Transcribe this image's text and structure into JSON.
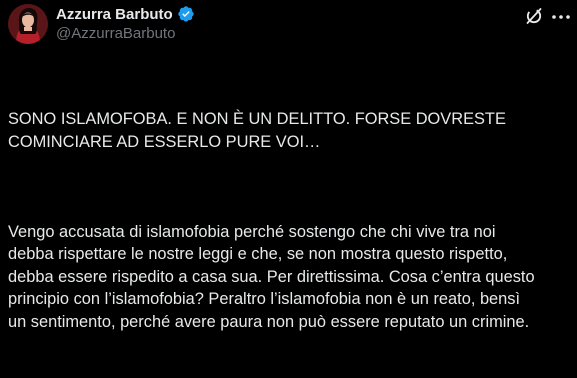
{
  "post": {
    "author": {
      "display_name": "Azzurra Barbuto",
      "handle": "@AzzurraBarbuto",
      "verified": true
    },
    "icons": {
      "avatar": "profile-photo",
      "verified": "verified-badge-icon",
      "grok": "grok-icon",
      "more": "more-options-icon"
    },
    "paragraphs": [
      "SONO ISLAMOFOBA. E NON È UN DELITTO. FORSE DOVRESTE\nCOMINCIARE AD ESSERLO PURE VOI…",
      "Vengo accusata di islamofobia perché sostengo che chi vive tra noi\ndebba rispettare le nostre leggi e che, se non mostra questo rispetto,\ndebba essere rispedito a casa sua. Per direttissima. Cosa c’entra questo\nprincipio con l’islamofobia? Peraltro l’islamofobia non è un reato, bensì\nun sentimento, perché avere paura non può essere reputato un crimine."
    ]
  },
  "colors": {
    "background": "#000000",
    "text_primary": "#e7e9ea",
    "text_secondary": "#71767b",
    "verified_blue": "#1d9bf0"
  }
}
